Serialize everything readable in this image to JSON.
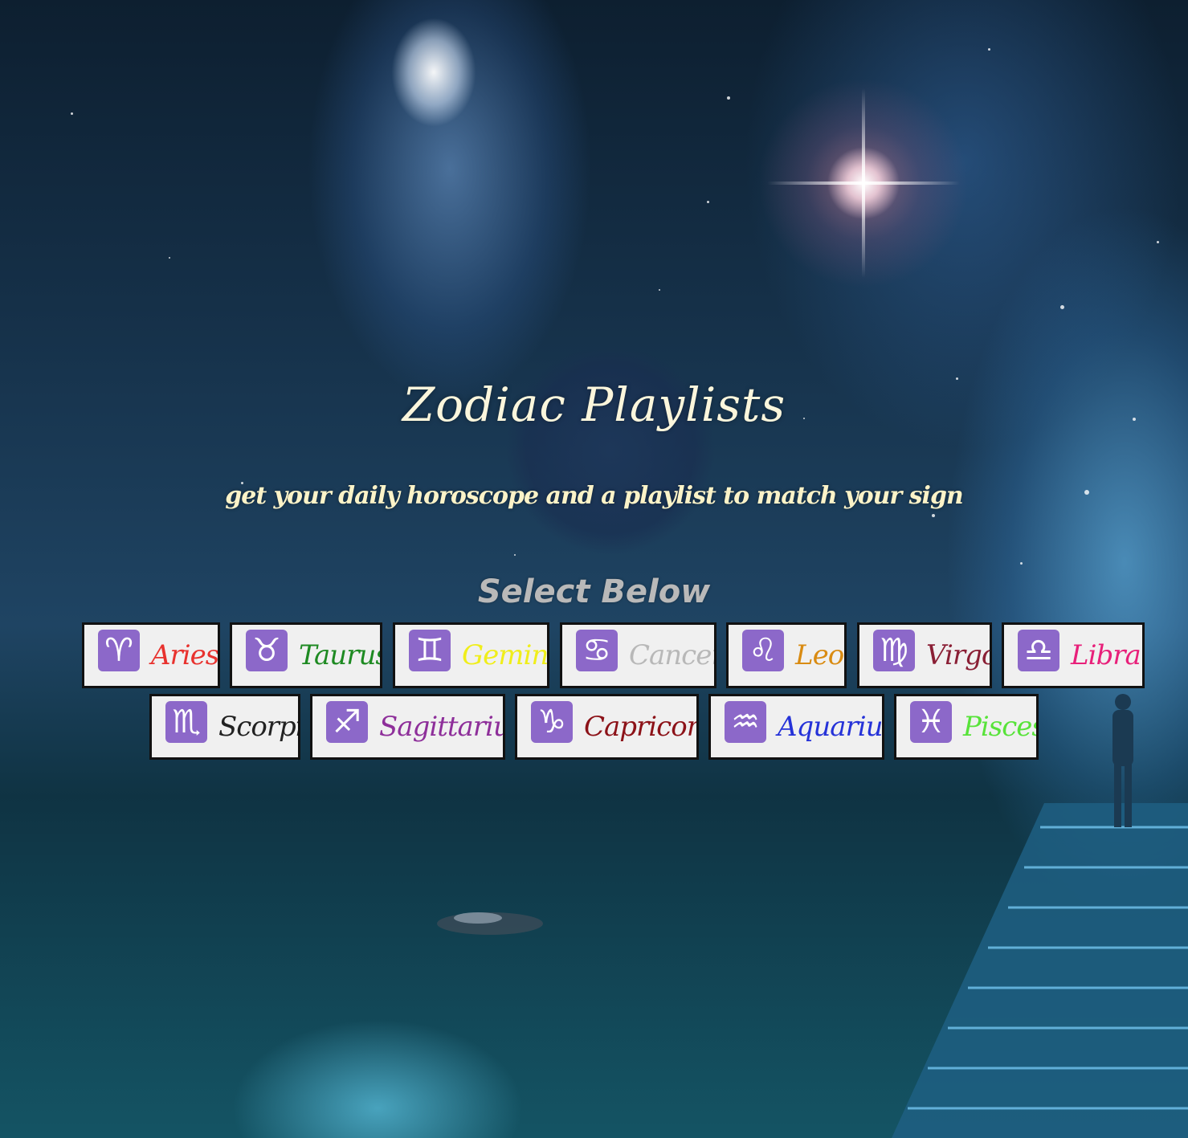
{
  "page": {
    "title": "Zodiac Playlists",
    "subtitle": "get your daily horoscope and a playlist to match your sign",
    "select_prompt": "Select Below"
  },
  "signs": [
    {
      "label": "Aries",
      "glyph": "♈",
      "icon": "aries-icon",
      "color": "#e8322e"
    },
    {
      "label": "Taurus",
      "glyph": "♉",
      "icon": "taurus-icon",
      "color": "#1e8a22"
    },
    {
      "label": "Gemini",
      "glyph": "♊",
      "icon": "gemini-icon",
      "color": "#f0ee1a"
    },
    {
      "label": "Cancer",
      "glyph": "♋",
      "icon": "cancer-icon",
      "color": "#b8b8b8"
    },
    {
      "label": "Leo",
      "glyph": "♌",
      "icon": "leo-icon",
      "color": "#d98b12"
    },
    {
      "label": "Virgo",
      "glyph": "♍",
      "icon": "virgo-icon",
      "color": "#8a1f35"
    },
    {
      "label": "Libra",
      "glyph": "♎",
      "icon": "libra-icon",
      "color": "#e8207a"
    },
    {
      "label": "Scorpio",
      "glyph": "♏",
      "icon": "scorpio-icon",
      "color": "#222222"
    },
    {
      "label": "Sagittarius",
      "glyph": "♐",
      "icon": "sagittarius-icon",
      "color": "#8e2f9a"
    },
    {
      "label": "Capricorn",
      "glyph": "♑",
      "icon": "capricorn-icon",
      "color": "#8c1218"
    },
    {
      "label": "Aquarius",
      "glyph": "♒",
      "icon": "aquarius-icon",
      "color": "#2532d8"
    },
    {
      "label": "Pisces",
      "glyph": "♓",
      "icon": "pisces-icon",
      "color": "#58e33a"
    }
  ],
  "colors": {
    "title": "#fbf6dc",
    "subtitle": "#fbf3c8",
    "select_prompt": "#b9b9b9",
    "icon_bg": "#8c68c9",
    "button_bg": "#f0f0f0",
    "button_border": "#111111"
  }
}
